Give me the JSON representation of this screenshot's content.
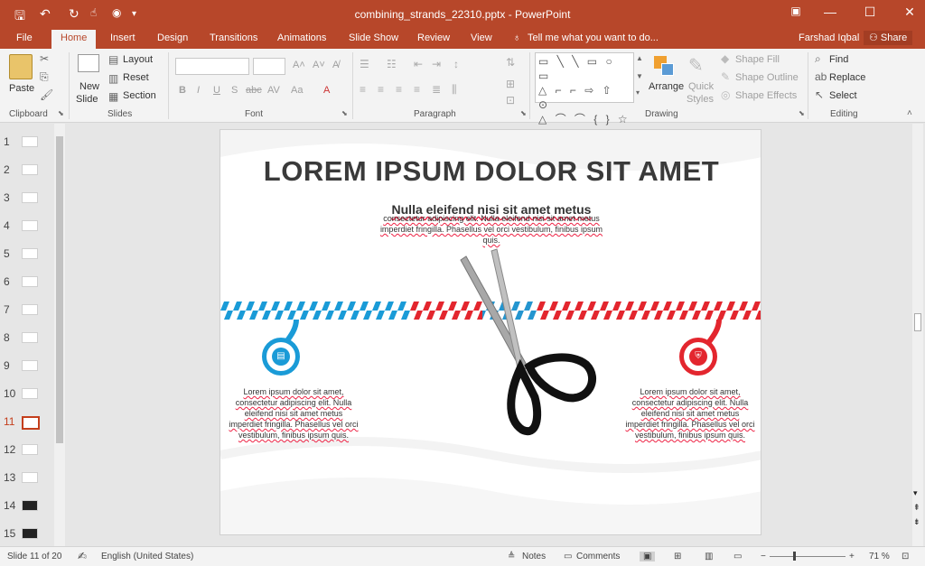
{
  "window": {
    "title": "combining_strands_22310.pptx - PowerPoint",
    "restore_icon": "ribbon-display-options-icon",
    "min_icon": "minimize-icon",
    "max_icon": "maximize-icon",
    "close_icon": "close-icon"
  },
  "tabs": [
    "File",
    "Home",
    "Insert",
    "Design",
    "Transitions",
    "Animations",
    "Slide Show",
    "Review",
    "View"
  ],
  "tellme": "Tell me what you want to do...",
  "user": "Farshad Iqbal",
  "share": "Share",
  "ribbon": {
    "clipboard": {
      "label": "Clipboard",
      "paste": "Paste"
    },
    "slides": {
      "label": "Slides",
      "new_slide": "New",
      "new_slide2": "Slide",
      "layout": "Layout",
      "reset": "Reset",
      "section": "Section"
    },
    "font": {
      "label": "Font"
    },
    "paragraph": {
      "label": "Paragraph"
    },
    "drawing": {
      "label": "Drawing",
      "arrange": "Arrange",
      "quick": "Quick",
      "styles": "Styles",
      "shape_fill": "Shape Fill",
      "shape_outline": "Shape Outline",
      "shape_effects": "Shape Effects"
    },
    "editing": {
      "label": "Editing",
      "find": "Find",
      "replace": "Replace",
      "select": "Select"
    }
  },
  "thumbnails": [
    "1",
    "2",
    "3",
    "4",
    "5",
    "6",
    "7",
    "8",
    "9",
    "10",
    "11",
    "12",
    "13",
    "14",
    "15"
  ],
  "active_slide": 11,
  "slide": {
    "title": "LOREM IPSUM DOLOR SIT AMET",
    "subtitle": "Nulla eleifend nisi sit amet metus",
    "top_text": "consectetur adipiscing elit. Nulla eleifend nisi sit amet metus imperdiet fringilla. Phasellus vel orci vestibulum, finibus ipsum quis.",
    "left_text": "Lorem ipsum dolor sit amet, consectetur adipiscing elit. Nulla eleifend nisi sit amet metus imperdiet fringilla. Phasellus vel orci vestibulum, finibus ipsum quis.",
    "right_text": "Lorem ipsum dolor sit amet, consectetur adipiscing elit. Nulla eleifend nisi sit amet metus imperdiet fringilla. Phasellus vel orci vestibulum, finibus ipsum quis.",
    "colors": {
      "blue": "#1a9bd7",
      "red": "#e3262e"
    }
  },
  "status": {
    "slide_of": "Slide 11 of 20",
    "language": "English (United States)",
    "notes": "Notes",
    "comments": "Comments",
    "zoom": "71 %"
  }
}
